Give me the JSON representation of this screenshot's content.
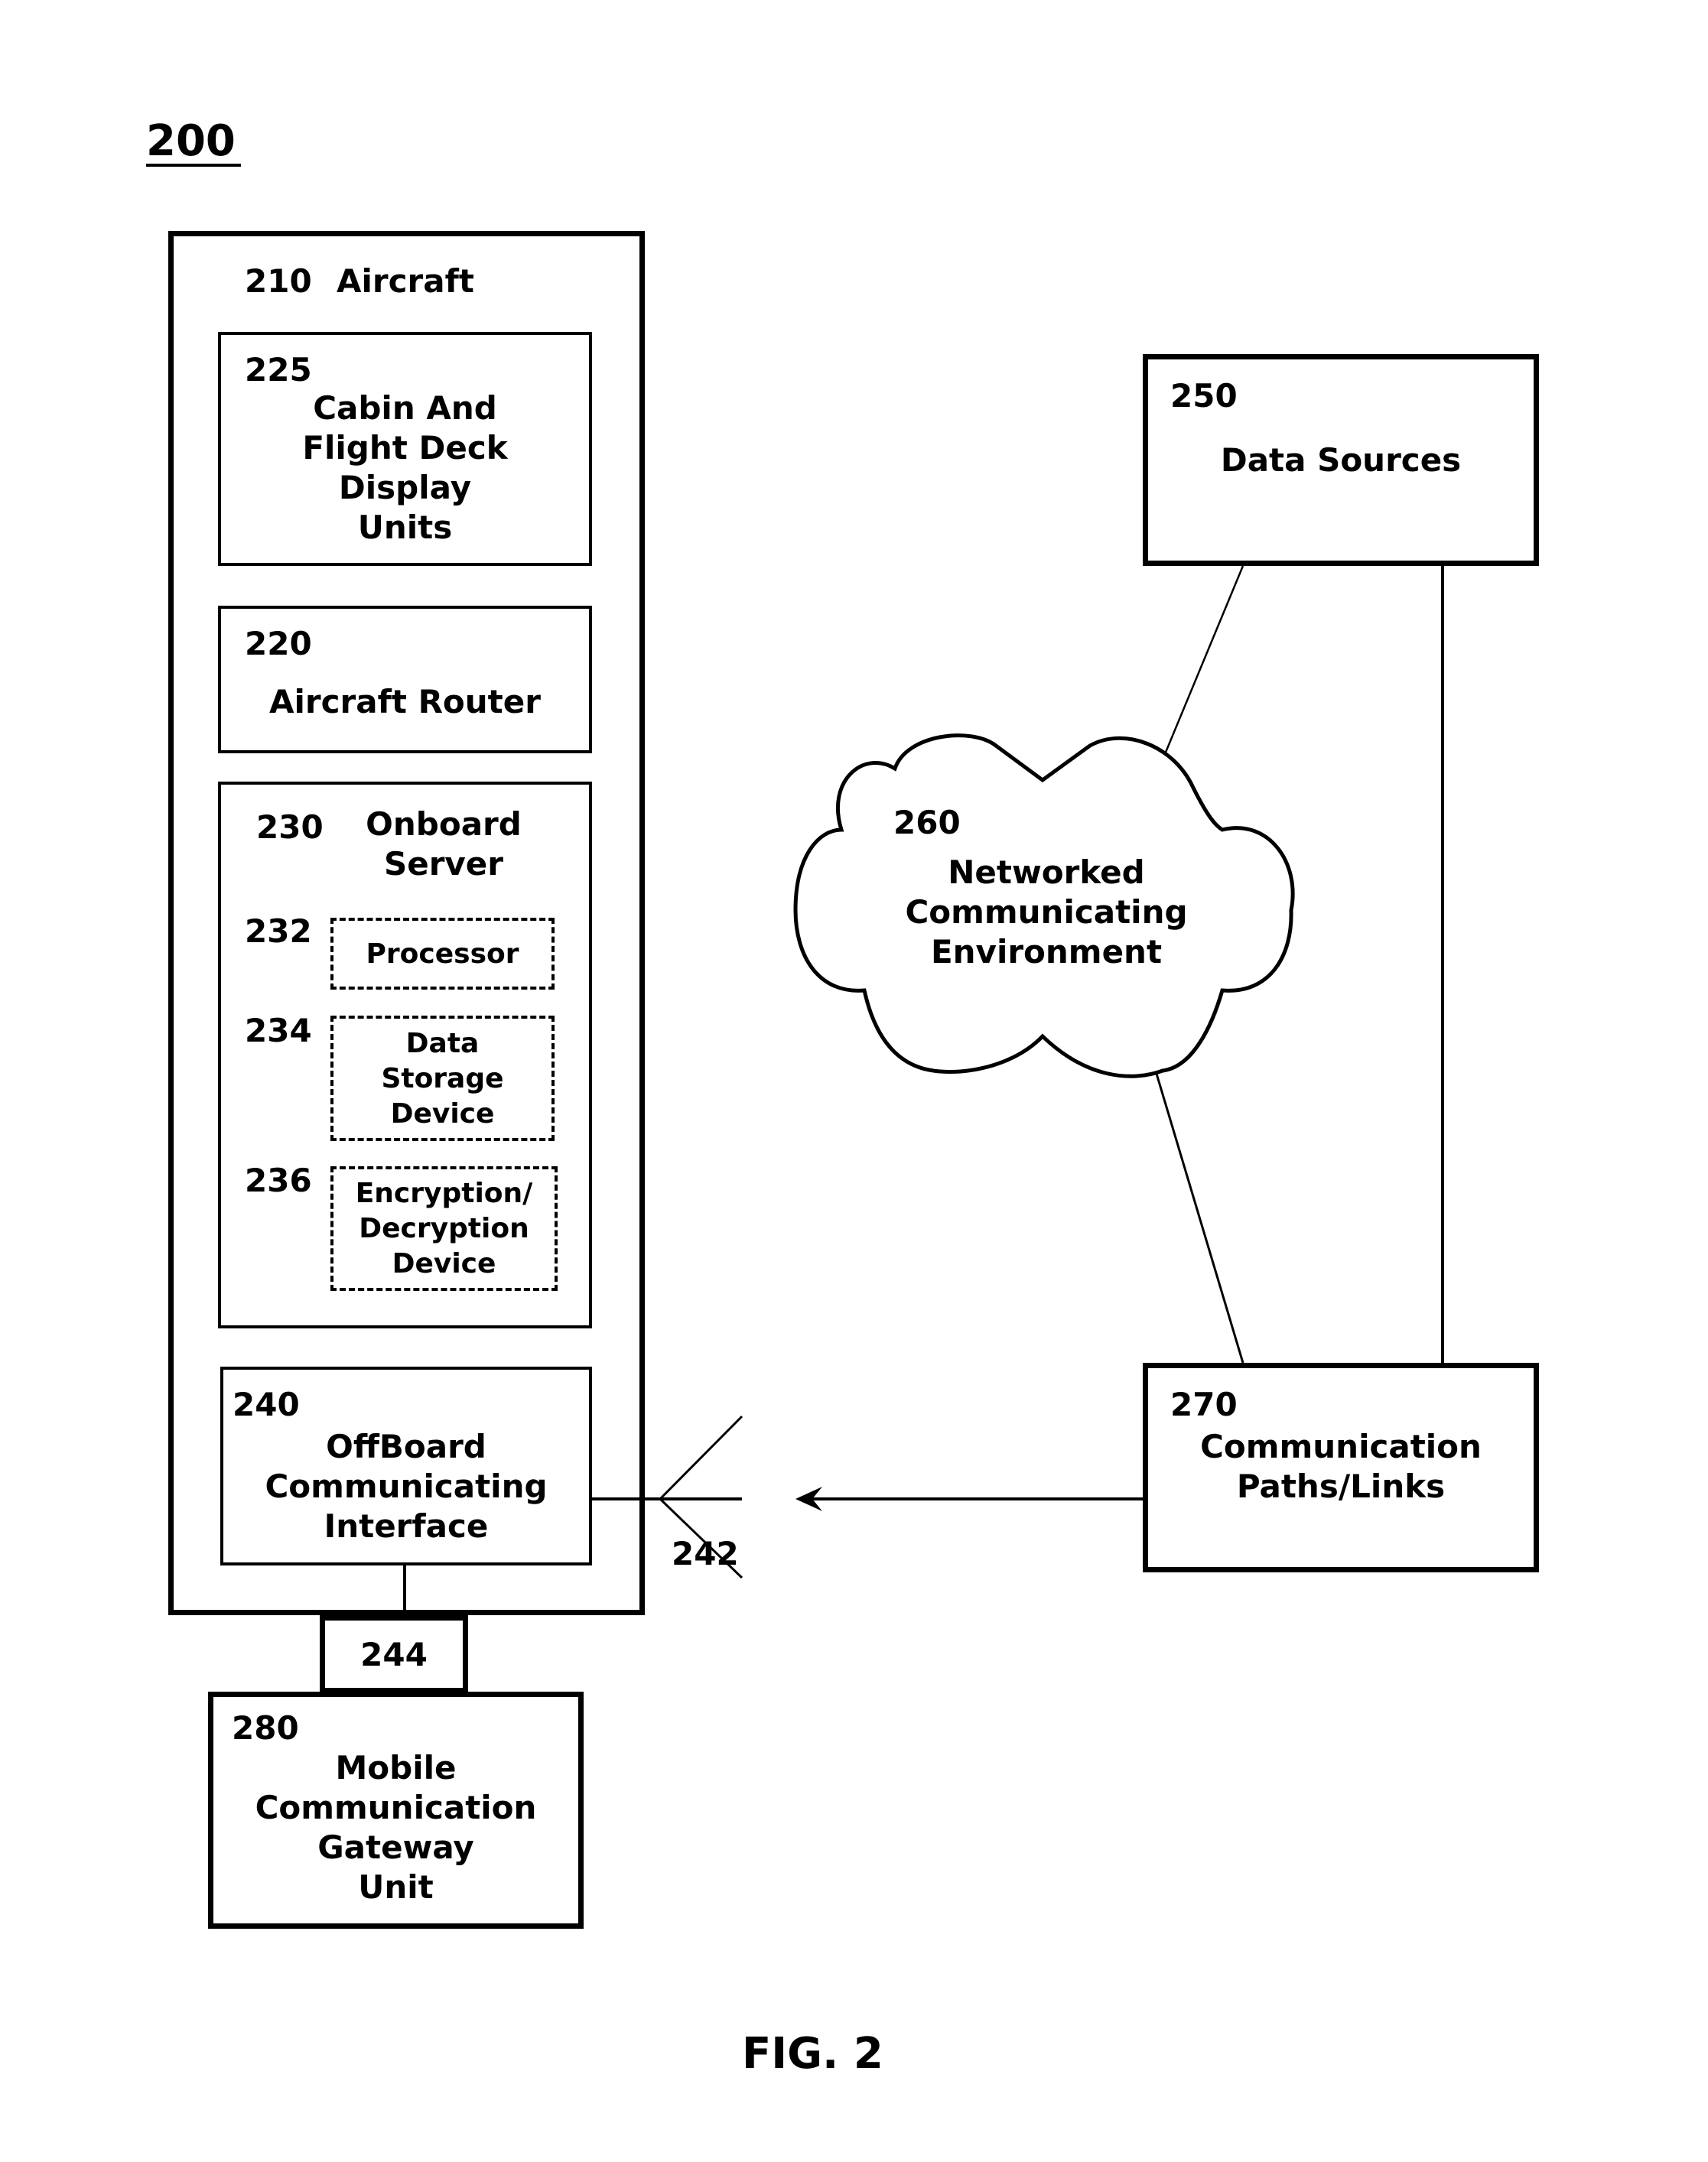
{
  "figure_number": "200",
  "caption": "FIG. 2",
  "aircraft": {
    "ref": "210",
    "label": "Aircraft"
  },
  "cabin_display": {
    "ref": "225",
    "lines": [
      "Cabin And",
      "Flight Deck",
      "Display",
      "Units"
    ]
  },
  "router": {
    "ref": "220",
    "label": "Aircraft Router"
  },
  "onboard_server": {
    "ref": "230",
    "lines": [
      "Onboard",
      "Server"
    ],
    "components": [
      {
        "ref": "232",
        "lines": [
          "Processor"
        ]
      },
      {
        "ref": "234",
        "lines": [
          "Data",
          "Storage",
          "Device"
        ]
      },
      {
        "ref": "236",
        "lines": [
          "Encryption/",
          "Decryption",
          "Device"
        ]
      }
    ]
  },
  "offboard_interface": {
    "ref": "240",
    "lines": [
      "OffBoard",
      "Communicating",
      "Interface"
    ]
  },
  "antenna": {
    "ref": "242"
  },
  "connector": {
    "ref": "244"
  },
  "mobile_gateway": {
    "ref": "280",
    "lines": [
      "Mobile",
      "Communication",
      "Gateway",
      "Unit"
    ]
  },
  "data_sources": {
    "ref": "250",
    "label": "Data Sources"
  },
  "network": {
    "ref": "260",
    "lines": [
      "Networked",
      "Communicating",
      "Environment"
    ]
  },
  "comm_paths": {
    "ref": "270",
    "lines": [
      "Communication",
      "Paths/Links"
    ]
  },
  "colors": {
    "ink": "#000000",
    "paper": "#ffffff"
  }
}
